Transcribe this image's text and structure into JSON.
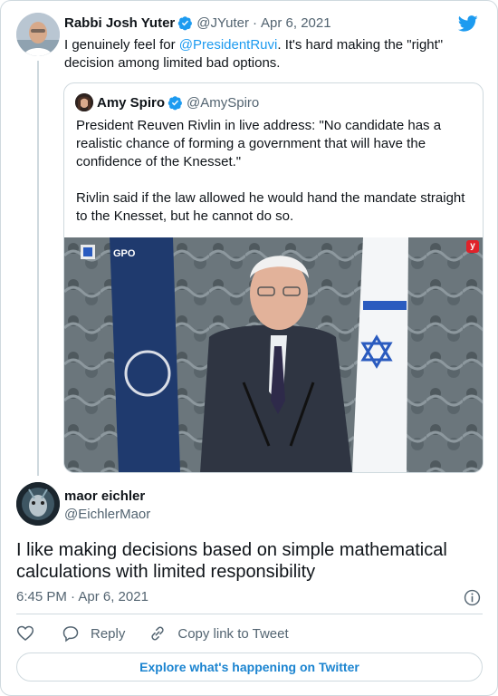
{
  "parent": {
    "name": "Rabbi Josh Yuter",
    "handle": "@JYuter",
    "separator": "·",
    "date": "Apr 6, 2021",
    "text_before": "I genuinely feel for ",
    "mention": "@PresidentRuvi",
    "text_after": ". It's hard making the \"right\" decision among limited bad options."
  },
  "quote": {
    "name": "Amy Spiro",
    "handle": "@AmySpiro",
    "para1": "President Reuven Rivlin in live address: \"No candidate has a realistic chance of forming a government that will have the confidence of the Knesset.\"",
    "para2": "Rivlin said if the law allowed he would hand the mandate straight to the Knesset, but he cannot do so.",
    "media_logo_text": "GPO",
    "media_corner_badge": "y"
  },
  "reply": {
    "name": "maor eichler",
    "handle": "@EichlerMaor",
    "text": "I like making decisions based on simple mathematical calculations with limited responsibility",
    "timestamp": "6:45 PM · Apr 6, 2021"
  },
  "actions": {
    "reply_label": "Reply",
    "copy_label": "Copy link to Tweet"
  },
  "explore_label": "Explore what's happening on Twitter",
  "icons": {
    "brand": "twitter-bird-icon",
    "verified": "verified-badge-icon",
    "like": "heart-icon",
    "reply": "reply-bubble-icon",
    "copy": "link-icon",
    "info": "info-icon"
  },
  "colors": {
    "accent": "#1d9bf0",
    "explore_text": "#1b84d0",
    "text": "#0f1419",
    "secondary": "#536471",
    "border": "#cfd9de"
  }
}
